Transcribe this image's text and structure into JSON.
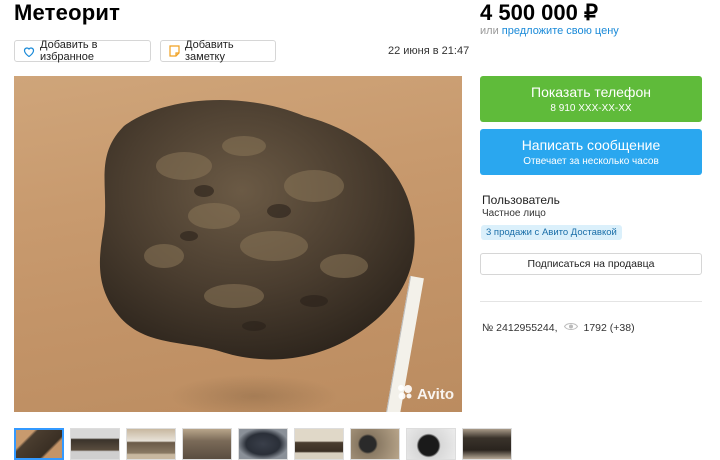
{
  "listing": {
    "title": "Метеорит",
    "date": "22 июня в 21:47",
    "price": "4 500 000 ₽",
    "price_or": "или",
    "price_offer_link": "предложите свою цену"
  },
  "actions": {
    "favorite_label": "Добавить в избранное",
    "note_label": "Добавить заметку"
  },
  "contact": {
    "phone_button": "Показать телефон",
    "phone_masked": "8 910 XXX-XX-XX",
    "message_button": "Написать сообщение",
    "message_subtitle": "Отвечает за несколько часов"
  },
  "seller": {
    "name": "Пользователь",
    "type": "Частное лицо",
    "badge": "3 продажи с Авито Доставкой",
    "subscribe_button": "Подписаться на продавца"
  },
  "stats": {
    "listing_number": "№ 2412955244,",
    "views": "1792 (+38)"
  },
  "photo": {
    "watermark": "Avito",
    "thumbnail_count": 9,
    "active_thumbnail": 1
  },
  "colors": {
    "phone_button": "#5fbb3a",
    "message_button": "#2aa7ef",
    "link": "#1a8ad8",
    "badge_bg": "#dbf0fb"
  }
}
